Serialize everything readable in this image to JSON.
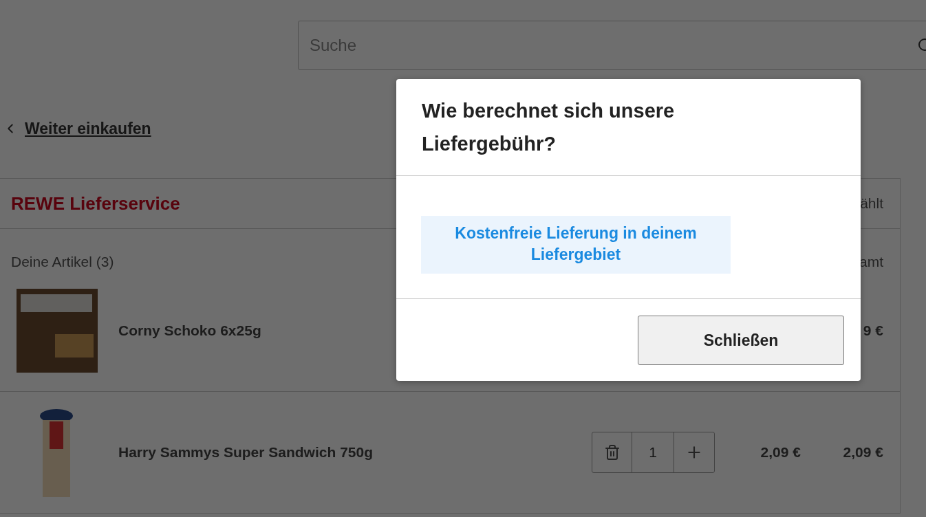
{
  "search": {
    "placeholder": "Suche"
  },
  "back_link": {
    "label": "Weiter einkaufen"
  },
  "cart": {
    "title": "REWE Lieferservice",
    "header_right": "ählt",
    "items_label": "Deine Artikel (3)",
    "column_right": "amt",
    "items": [
      {
        "kind": "single",
        "name": "Corny Schoko 6x25g",
        "total": "9 €"
      },
      {
        "kind": "quantity",
        "name": "Harry Sammys Super Sandwich 750g",
        "quantity": "1",
        "unit_price": "2,09 €",
        "total": "2,09 €"
      }
    ]
  },
  "dialog": {
    "title": "Wie berechnet sich unsere Liefergebühr?",
    "info": "Kostenfreie Lieferung in deinem Liefergebiet",
    "button": "Schließen"
  }
}
